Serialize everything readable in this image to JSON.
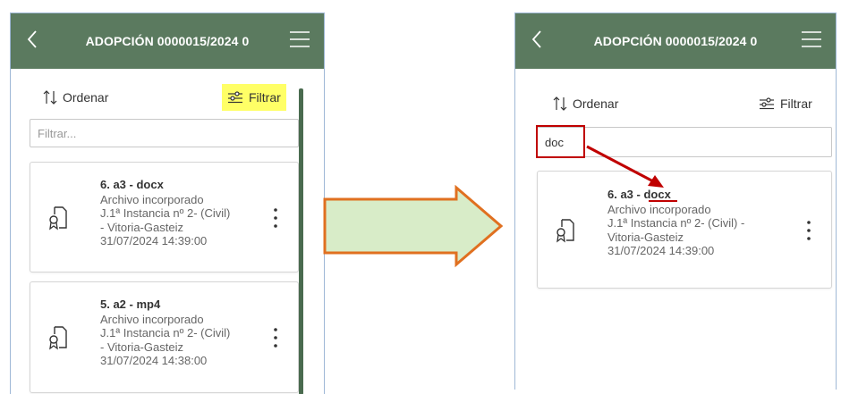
{
  "colors": {
    "appbar_bg": "#5b7a5f",
    "filter_highlight": "#ffff66",
    "annotation_red": "#c00000",
    "arrow_fill": "#d8ecc8",
    "arrow_stroke": "#e07020"
  },
  "left_screen": {
    "header": {
      "title": "ADOPCIÓN 0000015/2024 0"
    },
    "toolbar": {
      "sort_label": "Ordenar",
      "filter_label": "Filtrar"
    },
    "filter": {
      "value": "",
      "placeholder": "Filtrar..."
    },
    "cards": [
      {
        "name": "6. a3 - docx",
        "status": "Archivo incorporado",
        "court_line1": "J.1ª Instancia nº 2- (Civil)",
        "court_line2": "- Vitoria-Gasteiz",
        "date": "31/07/2024 14:39:00"
      },
      {
        "name": "5. a2 - mp4",
        "status": "Archivo incorporado",
        "court_line1": "J.1ª Instancia nº 2- (Civil)",
        "court_line2": "- Vitoria-Gasteiz",
        "date": "31/07/2024 14:38:00"
      }
    ]
  },
  "right_screen": {
    "header": {
      "title": "ADOPCIÓN 0000015/2024 0"
    },
    "toolbar": {
      "sort_label": "Ordenar",
      "filter_label": "Filtrar"
    },
    "filter": {
      "value": "doc",
      "placeholder": "Filtrar..."
    },
    "cards": [
      {
        "name_prefix": "6. a3 - ",
        "name_match": "docx",
        "status": "Archivo incorporado",
        "court_line1": "J.1ª Instancia nº 2- (Civil) -",
        "court_line2": "Vitoria-Gasteiz",
        "date": "31/07/2024 14:39:00"
      }
    ]
  },
  "icons": {
    "back": "chevron-left-icon",
    "menu": "hamburger-menu-icon",
    "sort": "sort-arrows-icon",
    "filter": "filter-sliders-icon",
    "document": "document-certificate-icon",
    "more": "more-vertical-icon"
  }
}
